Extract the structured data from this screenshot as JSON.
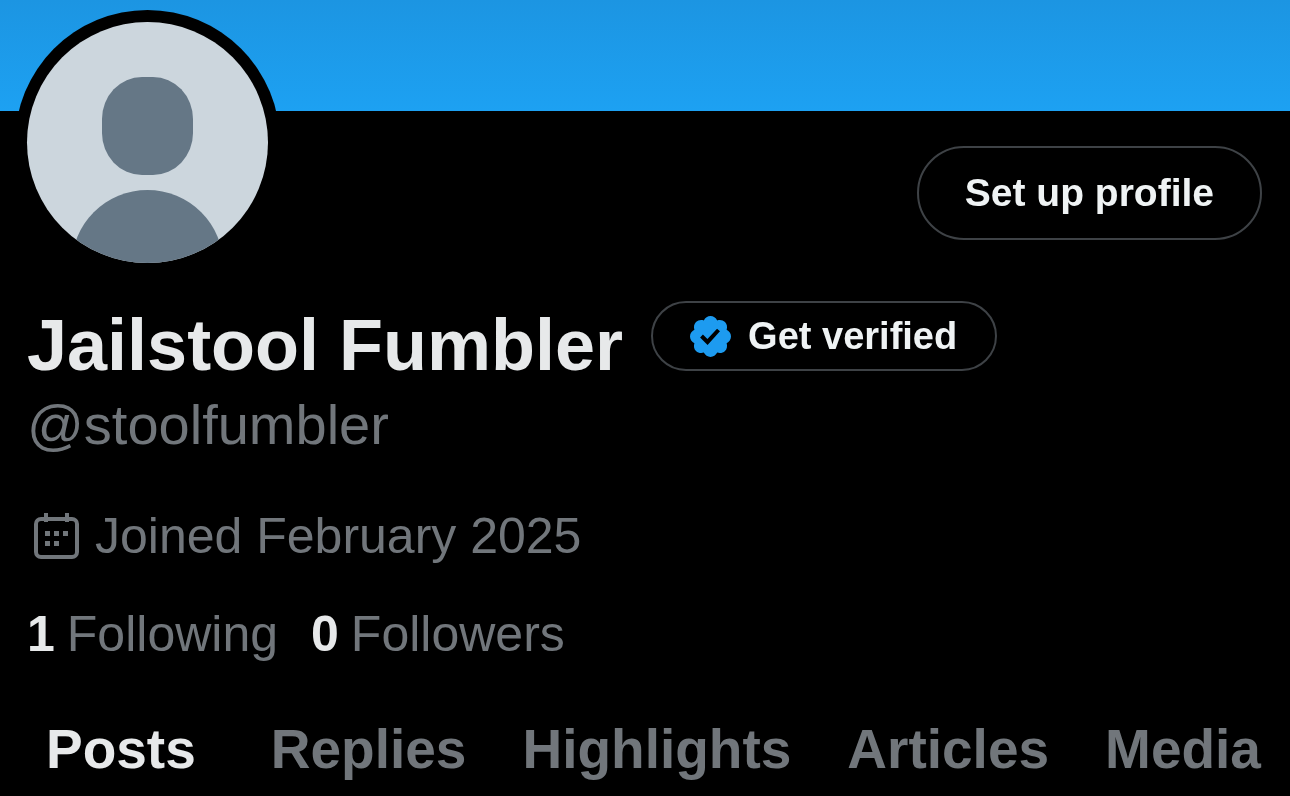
{
  "header_actions": {
    "setup_profile_button": "Set up profile"
  },
  "profile": {
    "display_name": "Jailstool Fumbler",
    "verify_button": "Get verified",
    "handle": "@stoolfumbler",
    "joined": "Joined February 2025"
  },
  "stats": [
    {
      "count": "1",
      "label": "Following"
    },
    {
      "count": "0",
      "label": "Followers"
    }
  ],
  "tabs": [
    {
      "label": "Posts",
      "selected": true
    },
    {
      "label": "Replies",
      "selected": false
    },
    {
      "label": "Highlights",
      "selected": false
    },
    {
      "label": "Articles",
      "selected": false
    },
    {
      "label": "Media",
      "selected": false
    }
  ]
}
